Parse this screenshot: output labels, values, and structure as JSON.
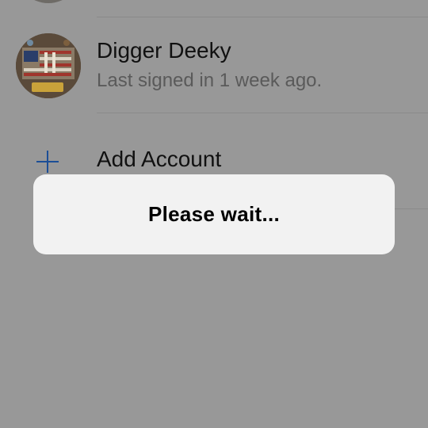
{
  "accounts": [
    {
      "name": "Digger Deeky",
      "last_signed_in": "Last signed in 1 week ago.",
      "avatar": "flag-collage-avatar"
    }
  ],
  "add_account": {
    "icon": "plus-icon",
    "label": "Add Account"
  },
  "dialog": {
    "message": "Please wait..."
  },
  "colors": {
    "background_dimmed": "#989898",
    "accent": "#1c4e96",
    "dialog_bg": "#f2f2f2"
  }
}
